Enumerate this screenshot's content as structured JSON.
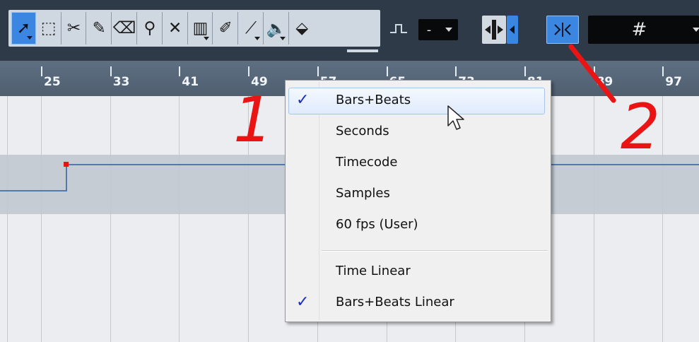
{
  "toolbar": {
    "tools": [
      {
        "name": "object-selection-tool-icon",
        "glyph": "➚",
        "active": true,
        "dropdown": true
      },
      {
        "name": "range-selection-tool-icon",
        "glyph": "⬚",
        "active": false,
        "dropdown": false
      },
      {
        "name": "split-tool-icon",
        "glyph": "✂",
        "active": false,
        "dropdown": false
      },
      {
        "name": "draw-tool-icon",
        "glyph": "✎",
        "active": false,
        "dropdown": false
      },
      {
        "name": "erase-tool-icon",
        "glyph": "⌫",
        "active": false,
        "dropdown": false
      },
      {
        "name": "zoom-tool-icon",
        "glyph": "⚲",
        "active": false,
        "dropdown": false
      },
      {
        "name": "mute-tool-icon",
        "glyph": "✕",
        "active": false,
        "dropdown": false
      },
      {
        "name": "comp-tool-icon",
        "glyph": "▥",
        "active": false,
        "dropdown": true
      },
      {
        "name": "pencil-tool-icon",
        "glyph": "✐",
        "active": false,
        "dropdown": false
      },
      {
        "name": "line-tool-icon",
        "glyph": "⟋",
        "active": false,
        "dropdown": true
      },
      {
        "name": "speaker-tool-icon",
        "glyph": "🔈",
        "active": false,
        "dropdown": true
      },
      {
        "name": "color-tool-icon",
        "glyph": "⬙",
        "active": false,
        "dropdown": false
      }
    ],
    "step_icon": "step-waveform-icon",
    "snap_type_value": "-",
    "snap_to_zero_icon": "snap-zero-crossing-icon",
    "snap_toggle_icon": "snap-icon",
    "grid_value": "#",
    "colors": {
      "bg": "#2e3a47",
      "active": "#3a86e0"
    }
  },
  "ruler": {
    "labels": [
      "25",
      "33",
      "41",
      "49",
      "57",
      "65",
      "73",
      "81",
      "89",
      "97"
    ]
  },
  "menu": {
    "items": [
      {
        "label": "Bars+Beats",
        "checked": true,
        "highlighted": true
      },
      {
        "label": "Seconds",
        "checked": false,
        "highlighted": false
      },
      {
        "label": "Timecode",
        "checked": false,
        "highlighted": false
      },
      {
        "label": "Samples",
        "checked": false,
        "highlighted": false
      },
      {
        "label": "60 fps (User)",
        "checked": false,
        "highlighted": false
      },
      {
        "label": "Time Linear",
        "checked": false,
        "highlighted": false
      },
      {
        "label": "Bars+Beats Linear",
        "checked": true,
        "highlighted": false
      }
    ],
    "check_glyph": "✓"
  },
  "annotations": {
    "one": "1",
    "two": "2",
    "color": "#ea1414"
  }
}
